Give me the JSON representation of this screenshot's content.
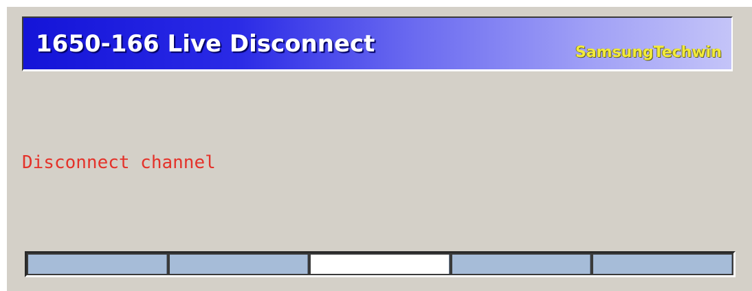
{
  "window": {
    "title": "1650-166 Live Disconnect",
    "brand": "SamsungTechwin"
  },
  "status": {
    "message": "Disconnect channel"
  },
  "progress": {
    "segment_count": 5,
    "active_segment_index": 2,
    "colors": {
      "segment": "#a6bcd8",
      "active_segment": "#ffffff"
    }
  },
  "colors": {
    "panel_background": "#d4d0c8",
    "title_gradient_start": "#1414d8",
    "title_gradient_end": "#c4c4f8",
    "title_text": "#ffffff",
    "brand_text": "#f2ea3a",
    "message_text": "#e4322a"
  }
}
